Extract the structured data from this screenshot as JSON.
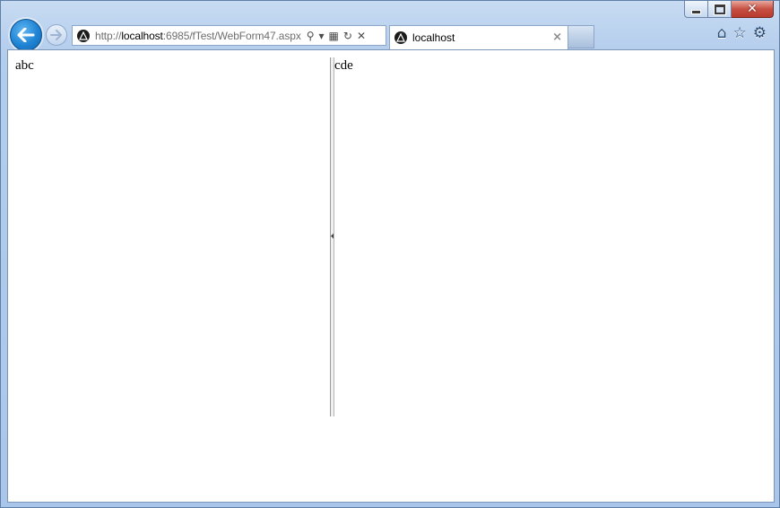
{
  "address_bar": {
    "url_prefix": "http://",
    "url_host": "localhost",
    "url_rest": ":6985/fTest/WebForm47.aspx"
  },
  "tab": {
    "label": "localhost",
    "close_glyph": "×"
  },
  "content": {
    "left_pane_text": "abc",
    "right_pane_text": "cde"
  },
  "colors": {
    "back_button": "#1f83d4",
    "chrome": "#b3cdec",
    "close_button": "#c75044"
  },
  "icons": {
    "back": "back-arrow-icon",
    "forward": "forward-arrow-icon",
    "search": "search-icon",
    "compat": "compatibility-view-icon",
    "refresh": "refresh-icon",
    "stop": "stop-icon",
    "home": "home-icon",
    "favorites": "star-icon",
    "tools": "gear-icon"
  }
}
